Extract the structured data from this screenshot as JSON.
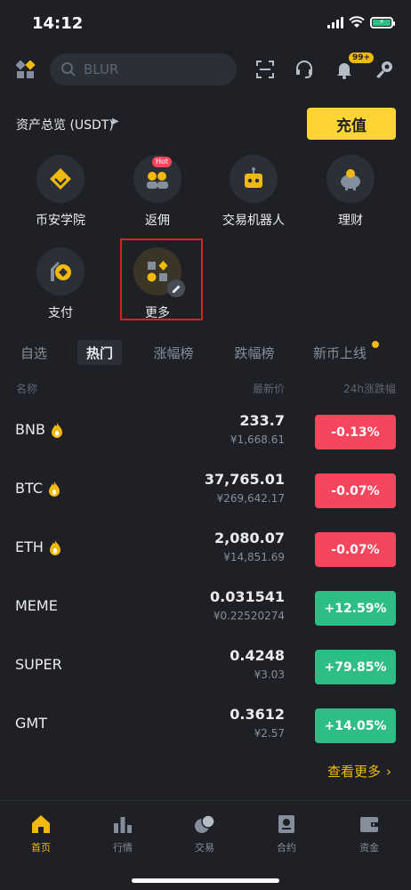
{
  "status_bar": {
    "time": "14:12"
  },
  "search": {
    "placeholder": "BLUR"
  },
  "notifications": {
    "badge": "99+"
  },
  "overview": {
    "label": "资产总览 (USDT)",
    "deposit_label": "充值"
  },
  "shortcuts": [
    {
      "label": "币安学院"
    },
    {
      "label": "返佣",
      "tag": "Hot"
    },
    {
      "label": "交易机器人"
    },
    {
      "label": "理财"
    },
    {
      "label": "支付"
    },
    {
      "label": "更多"
    }
  ],
  "market_tabs": [
    "自选",
    "热门",
    "涨幅榜",
    "跌幅榜",
    "新币上线"
  ],
  "active_tab": "热门",
  "columns": {
    "name": "名称",
    "price": "最新价",
    "change": "24h涨跌幅"
  },
  "rows": [
    {
      "symbol": "BNB",
      "price": "233.7",
      "fiat": "¥1,668.61",
      "change": "-0.13%",
      "direction": "down",
      "flame": true
    },
    {
      "symbol": "BTC",
      "price": "37,765.01",
      "fiat": "¥269,642.17",
      "change": "-0.07%",
      "direction": "down",
      "flame": true
    },
    {
      "symbol": "ETH",
      "price": "2,080.07",
      "fiat": "¥14,851.69",
      "change": "-0.07%",
      "direction": "down",
      "flame": true
    },
    {
      "symbol": "MEME",
      "price": "0.031541",
      "fiat": "¥0.22520274",
      "change": "+12.59%",
      "direction": "up",
      "flame": false
    },
    {
      "symbol": "SUPER",
      "price": "0.4248",
      "fiat": "¥3.03",
      "change": "+79.85%",
      "direction": "up",
      "flame": false
    },
    {
      "symbol": "GMT",
      "price": "0.3612",
      "fiat": "¥2.57",
      "change": "+14.05%",
      "direction": "up",
      "flame": false
    }
  ],
  "view_more": "查看更多",
  "bottom_nav": [
    {
      "label": "首页",
      "icon": "home-icon",
      "active": true
    },
    {
      "label": "行情",
      "icon": "markets-icon",
      "active": false
    },
    {
      "label": "交易",
      "icon": "trade-icon",
      "active": false
    },
    {
      "label": "合约",
      "icon": "futures-icon",
      "active": false
    },
    {
      "label": "资金",
      "icon": "wallet-icon",
      "active": false
    }
  ],
  "colors": {
    "accent": "#f0b90b",
    "up": "#2ebd85",
    "down": "#f6465d",
    "background": "#1e2026"
  }
}
